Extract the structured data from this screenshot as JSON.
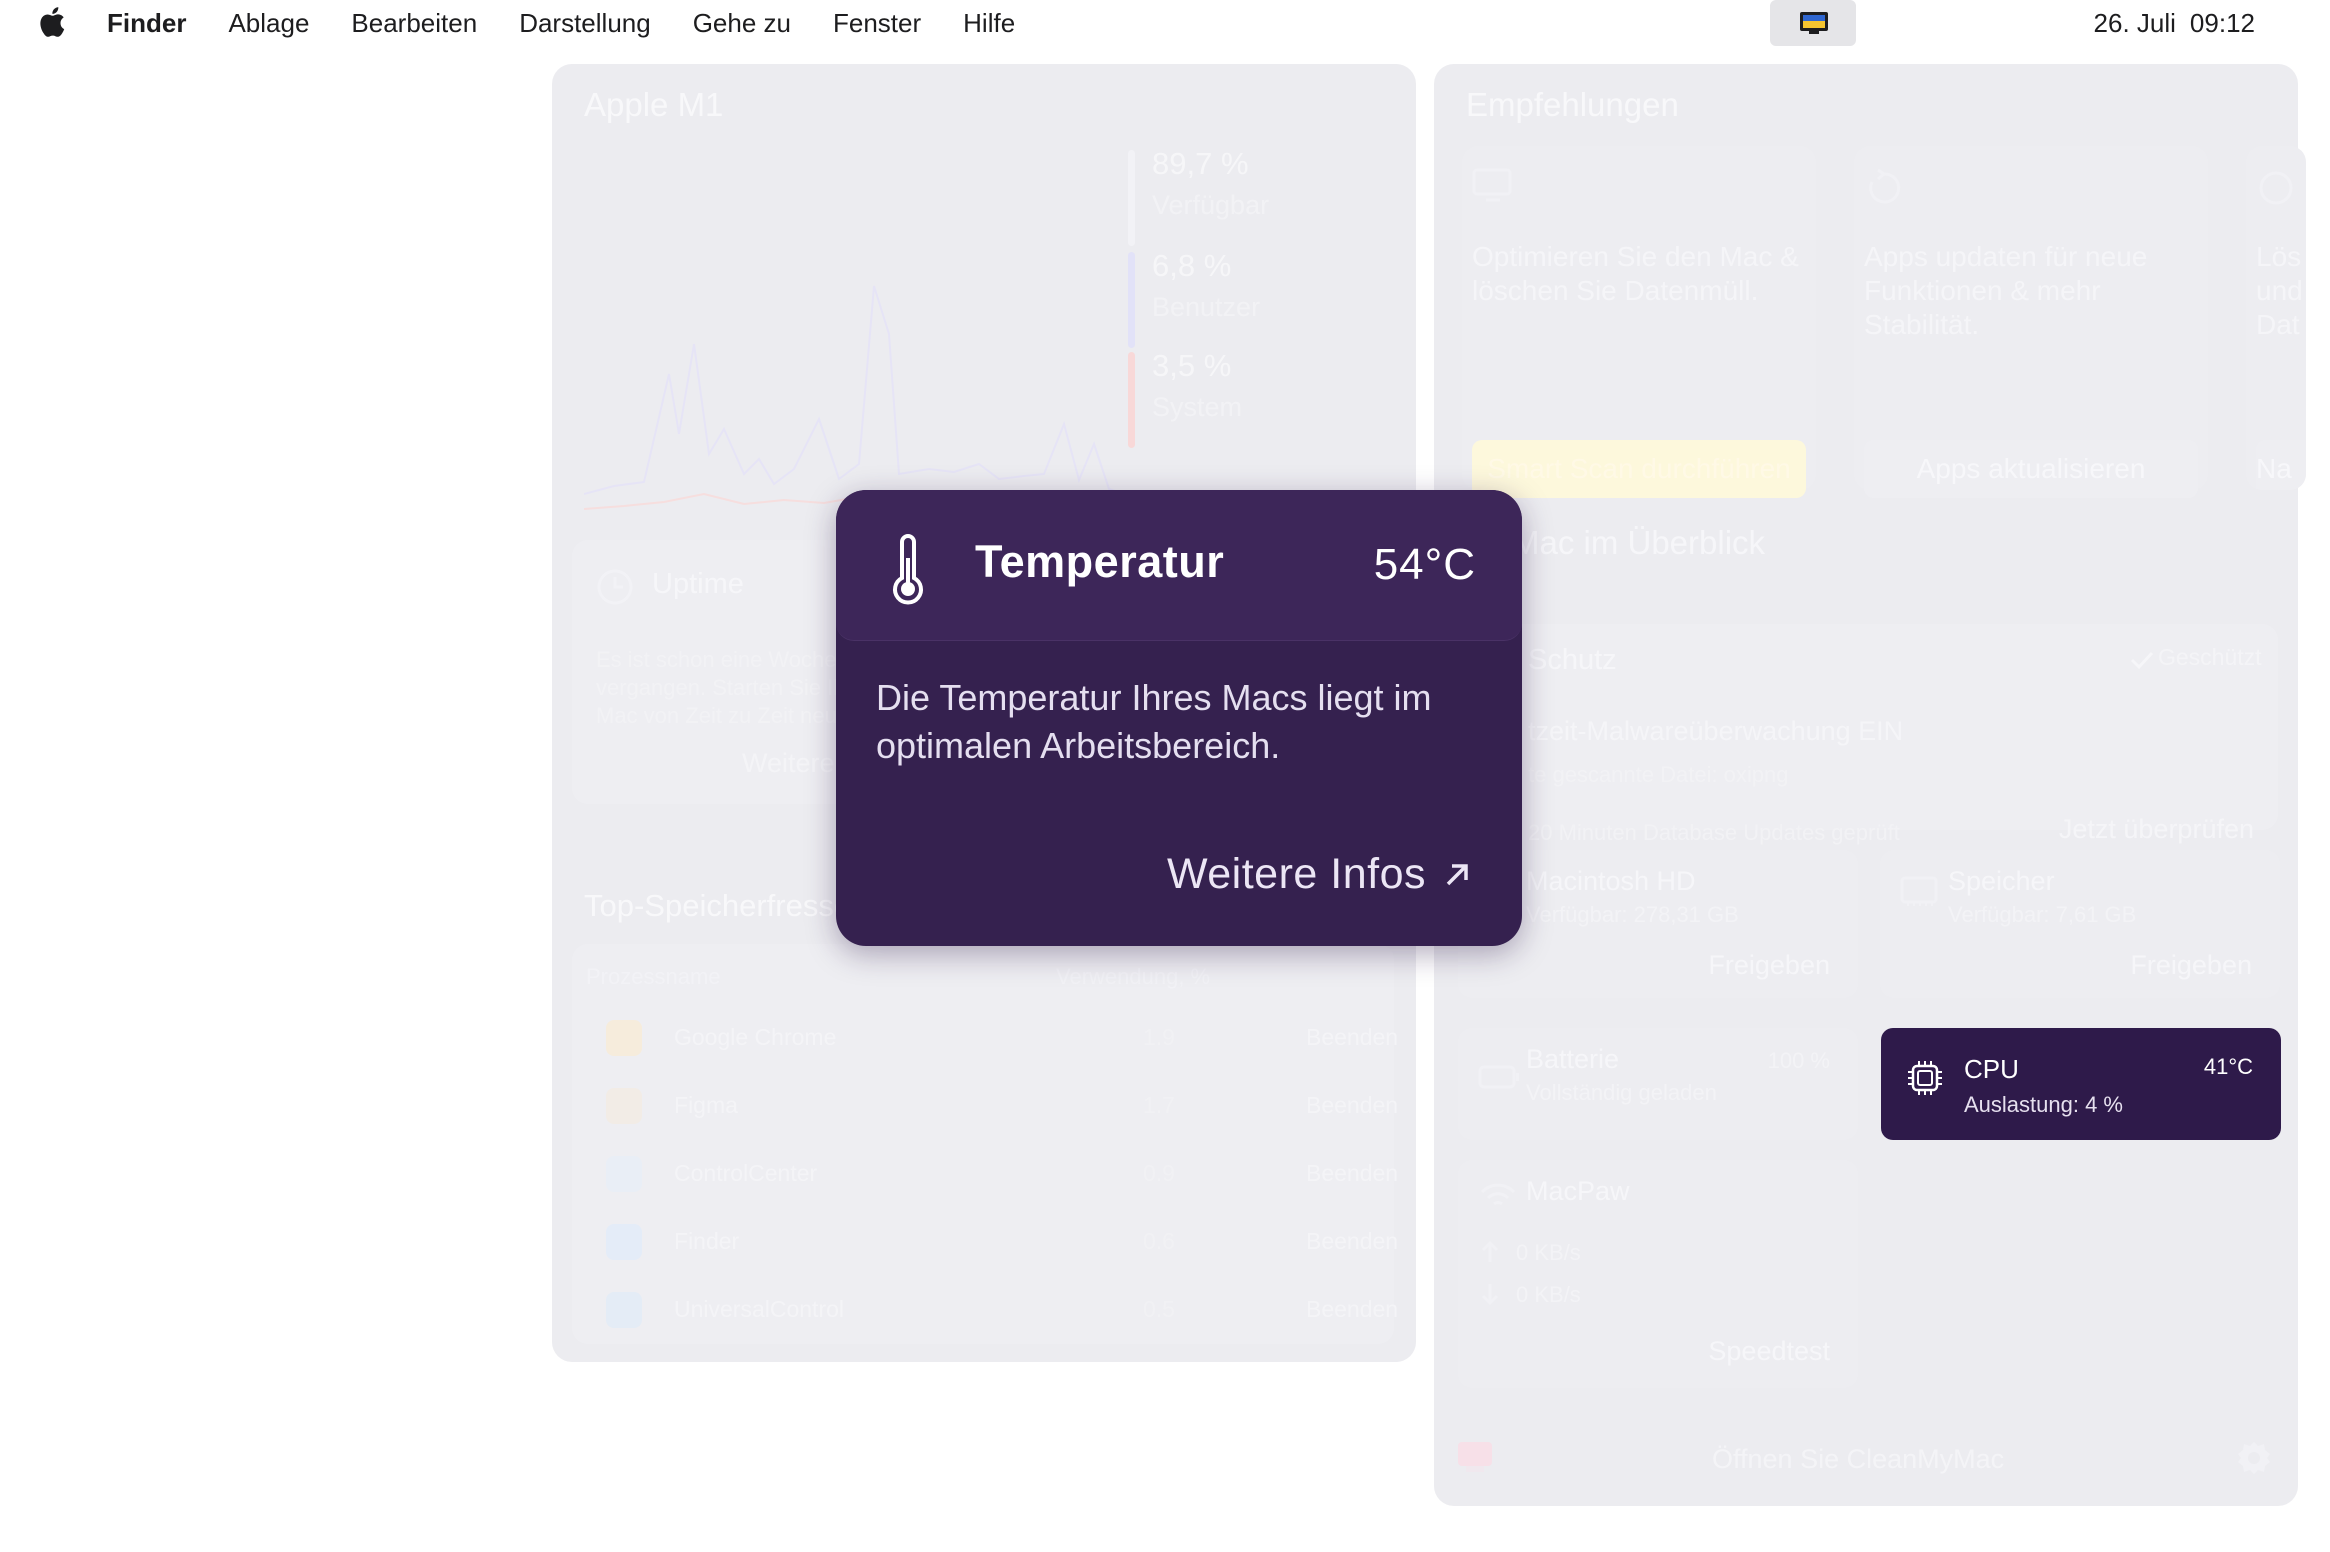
{
  "menubar": {
    "app_name": "Finder",
    "menus": [
      "Ablage",
      "Bearbeiten",
      "Darstellung",
      "Gehe zu",
      "Fenster",
      "Hilfe"
    ],
    "date": "26. Juli",
    "time": "09:12"
  },
  "cpu_panel": {
    "title": "Apple M1",
    "stats": [
      {
        "value": "89,7 %",
        "label": "Verfügbar",
        "color": "#f2f2f6"
      },
      {
        "value": "6,8 %",
        "label": "Benutzer",
        "color": "#e2e2f8"
      },
      {
        "value": "3,5 %",
        "label": "System",
        "color": "#f8d8d8"
      }
    ]
  },
  "uptime": {
    "title": "Uptime",
    "text": "Es ist schon eine Woche vergangen. Starten Sie Ihren Mac von Zeit zu Zeit neu.",
    "action": "Weitere Infos"
  },
  "memory_consumers": {
    "title": "Top-Speicherfresser",
    "col_name": "Prozessname",
    "col_usage": "Verwendung, %",
    "rows": [
      {
        "name": "Google Chrome",
        "usage": "1.9",
        "action": "Beenden"
      },
      {
        "name": "Figma",
        "usage": "1.7",
        "action": "Beenden"
      },
      {
        "name": "ControlCenter",
        "usage": "0.9",
        "action": "Beenden"
      },
      {
        "name": "Finder",
        "usage": "0.6",
        "action": "Beenden"
      },
      {
        "name": "UniversalControl",
        "usage": "0.5",
        "action": "Beenden"
      }
    ]
  },
  "recommendations": {
    "title": "Empfehlungen",
    "items": [
      {
        "text": "Optimieren Sie den Mac & löschen Sie Datenmüll.",
        "button": "Smart Scan durchführen"
      },
      {
        "text": "Apps updaten für neue Funktionen & mehr Stabilität.",
        "button": "Apps aktualisieren"
      },
      {
        "text": "Lös und Dat",
        "button": "Na"
      }
    ]
  },
  "overview": {
    "title": "Mac im Überblick",
    "protection": {
      "title": "Schutz",
      "status": "Geschützt",
      "line1": "tzeit-Malwareüberwachung EIN",
      "line2": "te gescannte Datei: oxipng",
      "line3": "20 Minuten Database Updates geprüft",
      "action": "Jetzt überprüfen"
    },
    "disk": {
      "title": "Macintosh HD",
      "sub": "Verfügbar: 278,31 GB",
      "action": "Freigeben"
    },
    "memory": {
      "title": "Speicher",
      "sub": "Verfügbar: 7,61 GB",
      "action": "Freigeben"
    },
    "battery": {
      "title": "Batterie",
      "value": "100 %",
      "sub": "Vollständig geladen"
    },
    "cpu": {
      "title": "CPU",
      "temp": "41°C",
      "sub": "Auslastung: 4 %"
    },
    "network": {
      "title": "MacPaw",
      "up": "0 KB/s",
      "down": "0 KB/s",
      "action": "Speedtest"
    }
  },
  "footer": {
    "open_label": "Öffnen Sie CleanMyMac"
  },
  "popup": {
    "title": "Temperatur",
    "temperature": "54°C",
    "description": "Die Temperatur Ihres Macs liegt im optimalen Arbeitsbereich.",
    "more_link": "Weitere Infos"
  }
}
